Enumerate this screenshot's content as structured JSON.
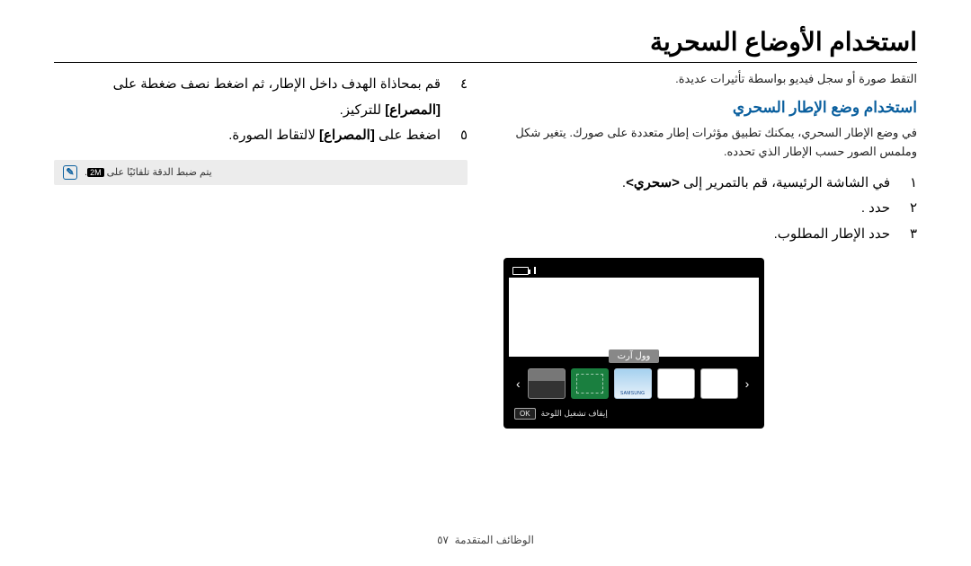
{
  "title": "استخدام الأوضاع السحرية",
  "right_col": {
    "intro": "التقط صورة أو سجل فيديو بواسطة تأثيرات عديدة.",
    "subhead": "استخدام وضع الإطار السحري",
    "desc": "في وضع الإطار السحري، يمكنك تطبيق مؤثرات إطار متعددة على صورك. يتغير شكل وملمس الصور حسب الإطار الذي تحدده.",
    "steps": [
      {
        "num": "١",
        "text_pre": "في الشاشة الرئيسية، قم بالتمرير إلى ",
        "bold": "<سحري>",
        "text_post": "."
      },
      {
        "num": "٢",
        "text_pre": "حدد ",
        "bold": "",
        "text_post": "."
      },
      {
        "num": "٣",
        "text_pre": "حدد الإطار المطلوب.",
        "bold": "",
        "text_post": ""
      }
    ]
  },
  "left_col": {
    "steps": [
      {
        "num": "٤",
        "text_pre": "قم بمحاذاة الهدف داخل الإطار، ثم اضغط نصف ضغطة على ",
        "bold": "[المصراع]",
        "text_post": " للتركيز."
      },
      {
        "num": "٥",
        "text_pre": "اضغط على ",
        "bold": "[المصراع]",
        "text_post": " لالتقاط الصورة."
      }
    ],
    "note": {
      "text": "يتم ضبط الدقة تلقائيًا على ",
      "badge": "2M"
    }
  },
  "device": {
    "label": "وول آرت",
    "bottom_text": "إيقاف تشغيل اللوحة",
    "ok": "OK"
  },
  "footer": {
    "section": "الوظائف المتقدمة",
    "page": "٥٧"
  }
}
